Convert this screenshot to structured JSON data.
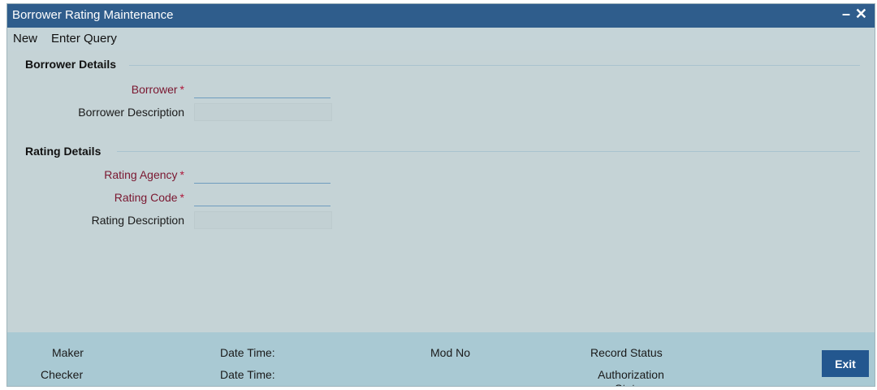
{
  "window": {
    "title": "Borrower Rating Maintenance",
    "minimize_icon": "minimize-icon",
    "close_icon": "close-icon"
  },
  "menu": {
    "new": "New",
    "enter_query": "Enter Query"
  },
  "borrower_details": {
    "heading": "Borrower Details",
    "borrower_label": "Borrower",
    "borrower_value": "",
    "description_label": "Borrower Description",
    "description_value": ""
  },
  "rating_details": {
    "heading": "Rating Details",
    "agency_label": "Rating Agency",
    "agency_value": "",
    "code_label": "Rating Code",
    "code_value": "",
    "description_label": "Rating Description",
    "description_value": ""
  },
  "required_marker": "*",
  "footer": {
    "maker": "Maker",
    "checker": "Checker",
    "maker_date_time": "Date Time:",
    "checker_date_time": "Date Time:",
    "mod_no": "Mod No",
    "record_status": "Record Status",
    "authorization_status": "Authorization Status",
    "exit": "Exit"
  },
  "colors": {
    "titlebar": "#2f5d8c",
    "required_label": "#7a1730",
    "exit_button": "#23578f"
  }
}
